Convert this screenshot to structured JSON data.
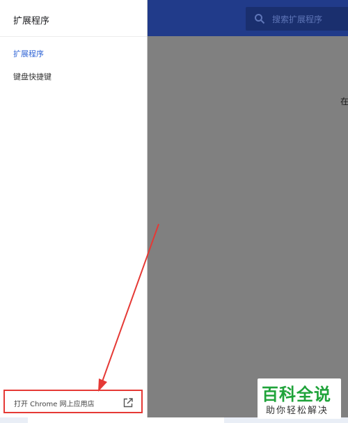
{
  "drawer": {
    "title": "扩展程序",
    "nav": [
      {
        "label": "扩展程序",
        "active": true
      },
      {
        "label": "键盘快捷键",
        "active": false
      }
    ],
    "store_link": {
      "label": "打开 Chrome 网上应用店",
      "icon": "open-in-new-icon"
    }
  },
  "header": {
    "search_placeholder": "搜索扩展程序",
    "search_icon": "search-icon"
  },
  "content": {
    "peek_text": "在"
  },
  "watermark": {
    "line1": "百科全说",
    "line2": "助你轻松解决"
  },
  "colors": {
    "header_bg": "#213b8a",
    "overlay": "#808080",
    "accent": "#3367d6",
    "highlight_red": "#e53935",
    "watermark_green": "#1fa33a"
  }
}
